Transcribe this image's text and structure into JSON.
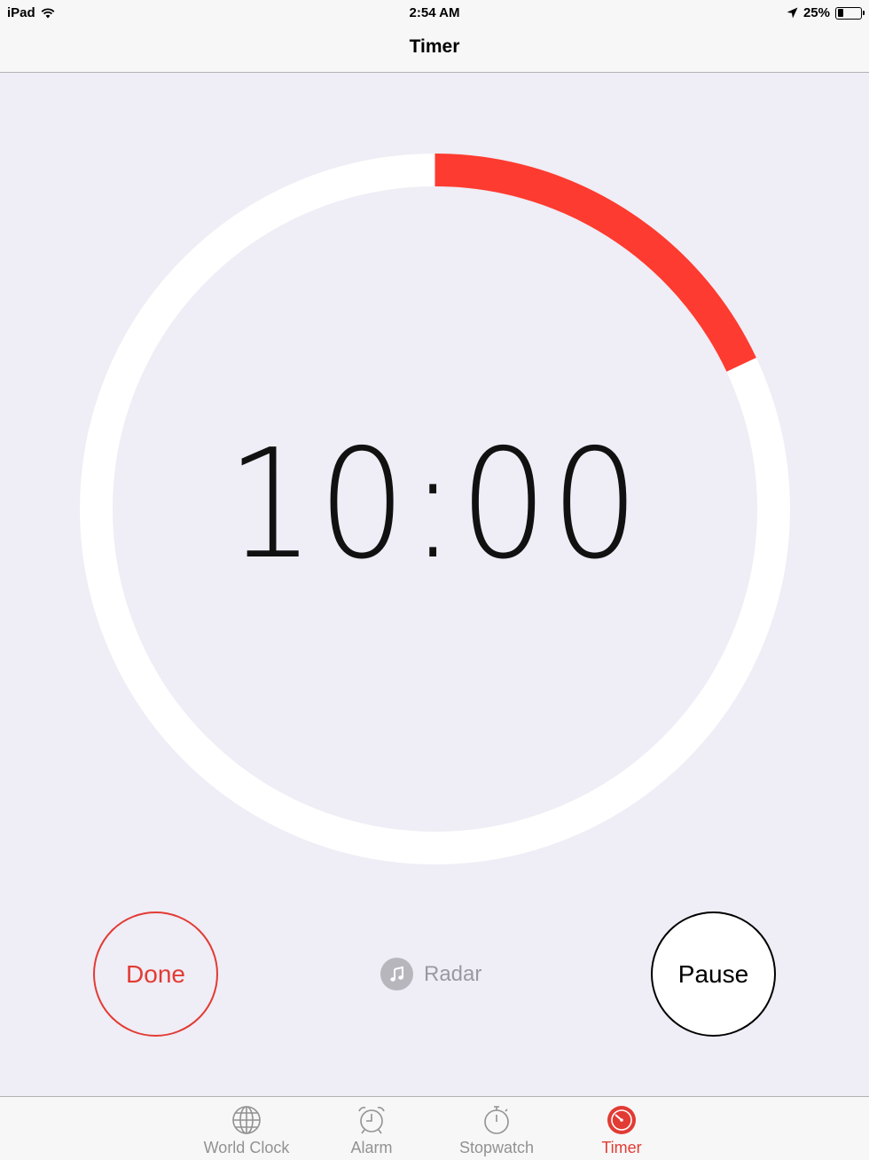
{
  "status_bar": {
    "device": "iPad",
    "time": "2:54 AM",
    "battery": "25%",
    "battery_level": 0.25
  },
  "nav": {
    "title": "Timer"
  },
  "timer": {
    "display": "10:00",
    "progress": 0.18,
    "colors": {
      "track": "#ffffff",
      "progress": "#fd3b30"
    }
  },
  "controls": {
    "done_label": "Done",
    "pause_label": "Pause",
    "sound_label": "Radar"
  },
  "tabs": [
    {
      "label": "World Clock",
      "icon": "globe-icon"
    },
    {
      "label": "Alarm",
      "icon": "alarm-clock-icon"
    },
    {
      "label": "Stopwatch",
      "icon": "stopwatch-icon"
    },
    {
      "label": "Timer",
      "icon": "timer-icon",
      "active": true
    }
  ],
  "colors": {
    "accent": "#e23b34",
    "background": "#efedf5"
  }
}
